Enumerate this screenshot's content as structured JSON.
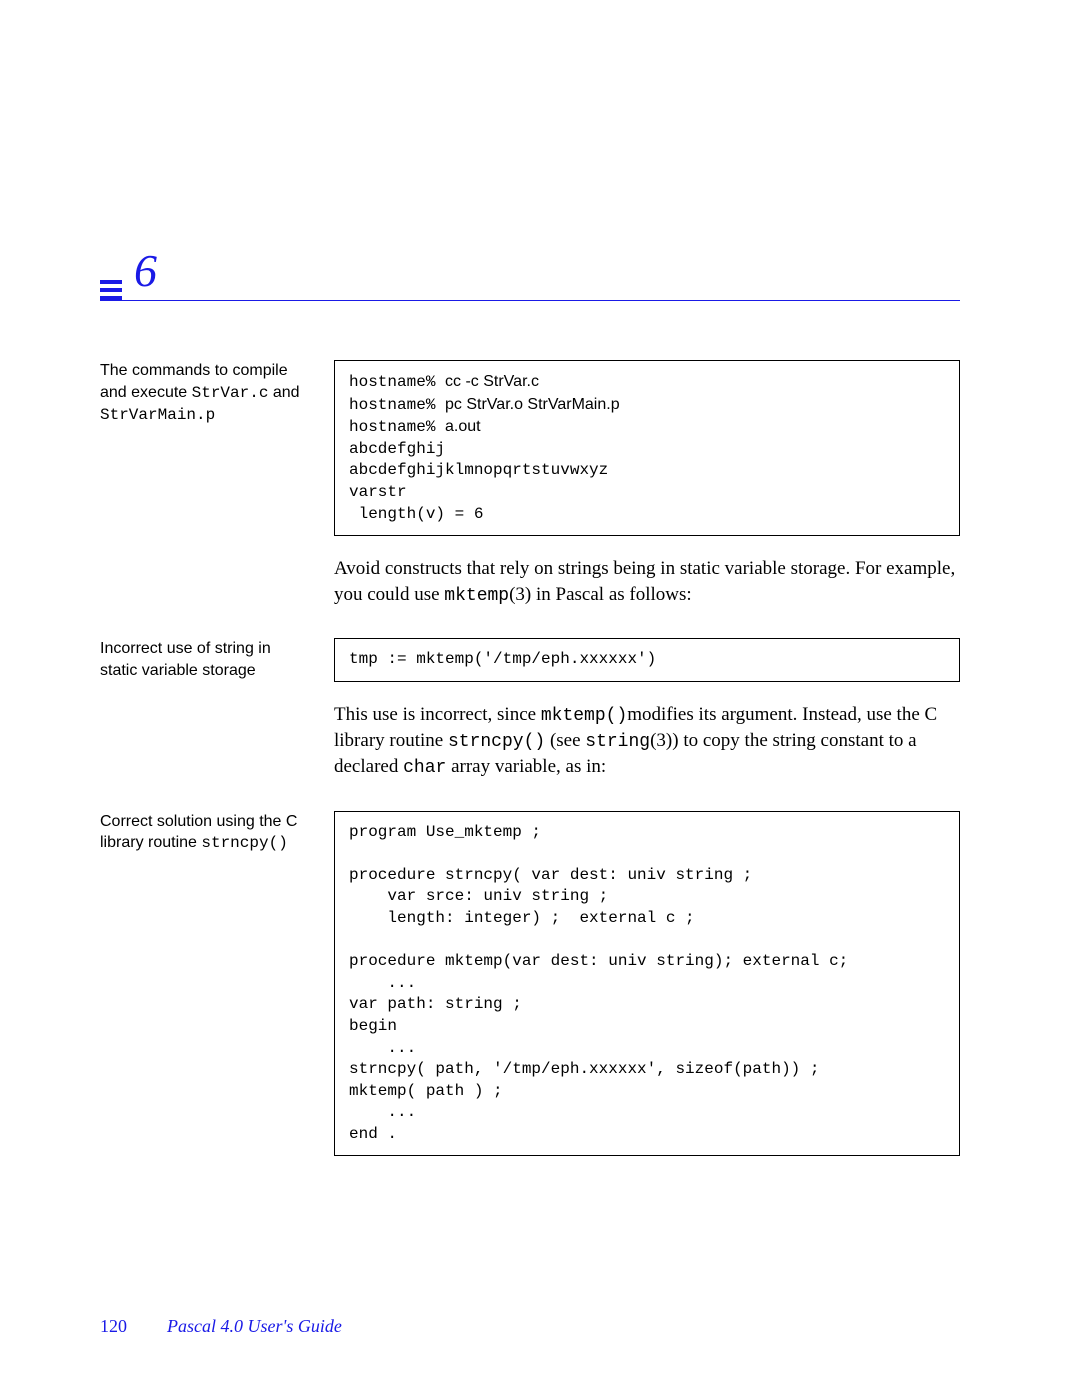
{
  "chapter_number": "6",
  "sections": [
    {
      "sidebar": {
        "pre": "The commands to compile and execute ",
        "code1": "StrVar.c",
        "mid": " and ",
        "code2": "StrVarMain.p"
      },
      "code_lines": [
        "hostname% cc -c StrVar.c",
        "hostname% pc StrVar.o StrVarMain.p",
        "hostname% a.out",
        "abcdefghij",
        "abcdefghijklmnopqrtstuvwxyz",
        "varstr",
        " length(v) = 6"
      ],
      "mixed_line_formats": {
        "0": {
          "prompt": "hostname% ",
          "sans": "cc -c StrVar.c"
        },
        "1": {
          "prompt": "hostname% ",
          "sans": "pc StrVar.o StrVarMain.p"
        },
        "2": {
          "prompt": "hostname% ",
          "sans": "a.out"
        }
      }
    },
    {
      "body": {
        "pre": "Avoid constructs that rely on strings being in static variable storage.  For example, you could use ",
        "code": "mktemp",
        "post": "(3) in Pascal as follows:"
      }
    },
    {
      "sidebar": {
        "text": "Incorrect use of string in static variable storage"
      },
      "code_lines": [
        "tmp := mktemp('/tmp/eph.xxxxxx')"
      ]
    },
    {
      "body_parts": [
        {
          "t": "text",
          "v": "This use is incorrect, since "
        },
        {
          "t": "code",
          "v": "mktemp()"
        },
        {
          "t": "text",
          "v": "modifies its argument.  Instead, use the C library routine "
        },
        {
          "t": "code",
          "v": "strncpy()"
        },
        {
          "t": "text",
          "v": " (see "
        },
        {
          "t": "code",
          "v": "string"
        },
        {
          "t": "text",
          "v": "(3)) to copy the string constant to a declared "
        },
        {
          "t": "code",
          "v": "char"
        },
        {
          "t": "text",
          "v": " array variable, as in:"
        }
      ]
    },
    {
      "sidebar": {
        "pre": "Correct solution using the C library routine ",
        "code1": "strncpy()"
      },
      "code_lines": [
        "program Use_mktemp ;",
        "",
        "procedure strncpy( var dest: univ string ;",
        "    var srce: univ string ;",
        "    length: integer) ;  external c ;",
        "",
        "procedure mktemp(var dest: univ string); external c;",
        "    ...",
        "var path: string ;",
        "begin",
        "    ...",
        "strncpy( path, '/tmp/eph.xxxxxx', sizeof(path)) ;",
        "mktemp( path ) ;",
        "    ...",
        "end ."
      ]
    }
  ],
  "footer": {
    "page": "120",
    "title": "Pascal 4.0 User's Guide"
  }
}
